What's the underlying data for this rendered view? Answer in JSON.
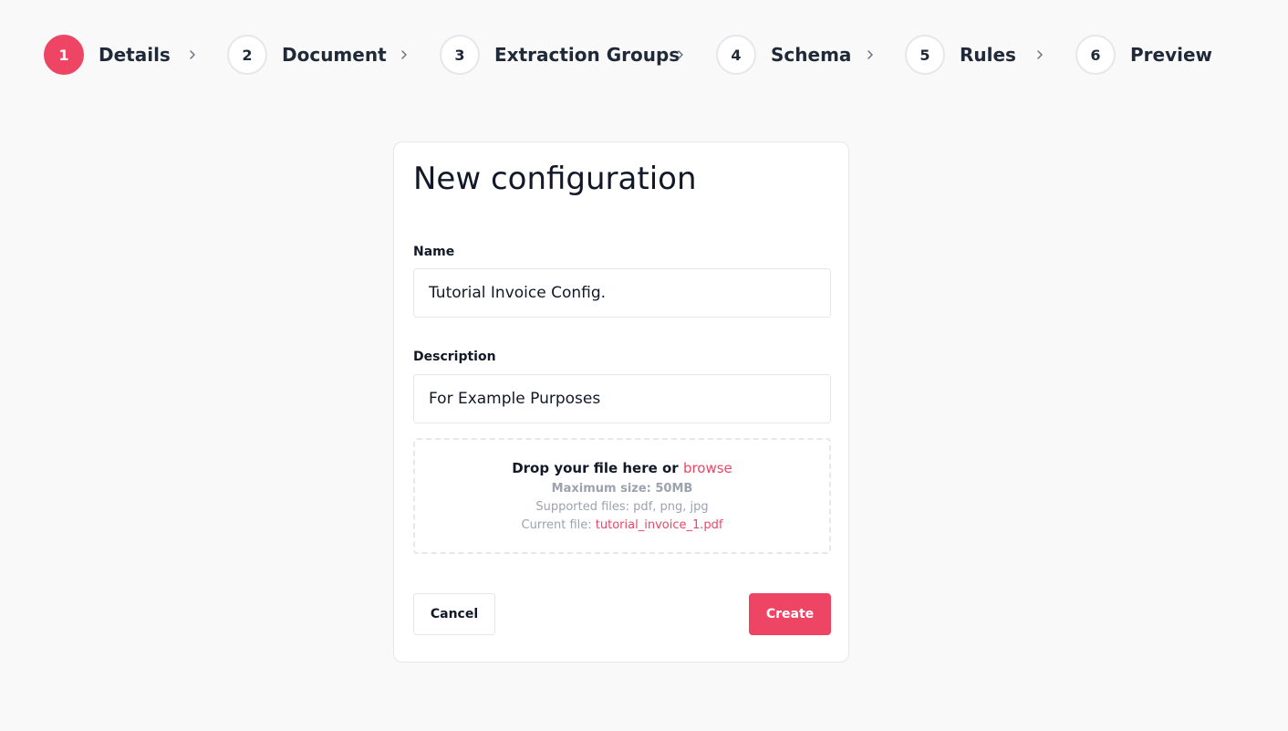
{
  "stepper": {
    "steps": [
      {
        "number": "1",
        "label": "Details",
        "active": true
      },
      {
        "number": "2",
        "label": "Document",
        "active": false
      },
      {
        "number": "3",
        "label": "Extraction Groups",
        "active": false
      },
      {
        "number": "4",
        "label": "Schema",
        "active": false
      },
      {
        "number": "5",
        "label": "Rules",
        "active": false
      },
      {
        "number": "6",
        "label": "Preview",
        "active": false
      }
    ],
    "separator_icon": "chevron-right-icon"
  },
  "form": {
    "title": "New configuration",
    "name_label": "Name",
    "name_value": "Tutorial Invoice Config.",
    "description_label": "Description",
    "description_value": "For Example Purposes"
  },
  "upload": {
    "prompt": "Drop your file here or",
    "browse_label": "browse",
    "max_size": "Maximum size: 50MB",
    "supported": "Supported files: pdf, png, jpg",
    "current_prefix": "Current file:",
    "current_file": "tutorial_invoice_1.pdf"
  },
  "actions": {
    "cancel_label": "Cancel",
    "create_label": "Create"
  },
  "colors": {
    "accent": "#ef4565",
    "background": "#f9f9f9",
    "border": "#e5e7eb",
    "muted_text": "#9ca3af"
  }
}
